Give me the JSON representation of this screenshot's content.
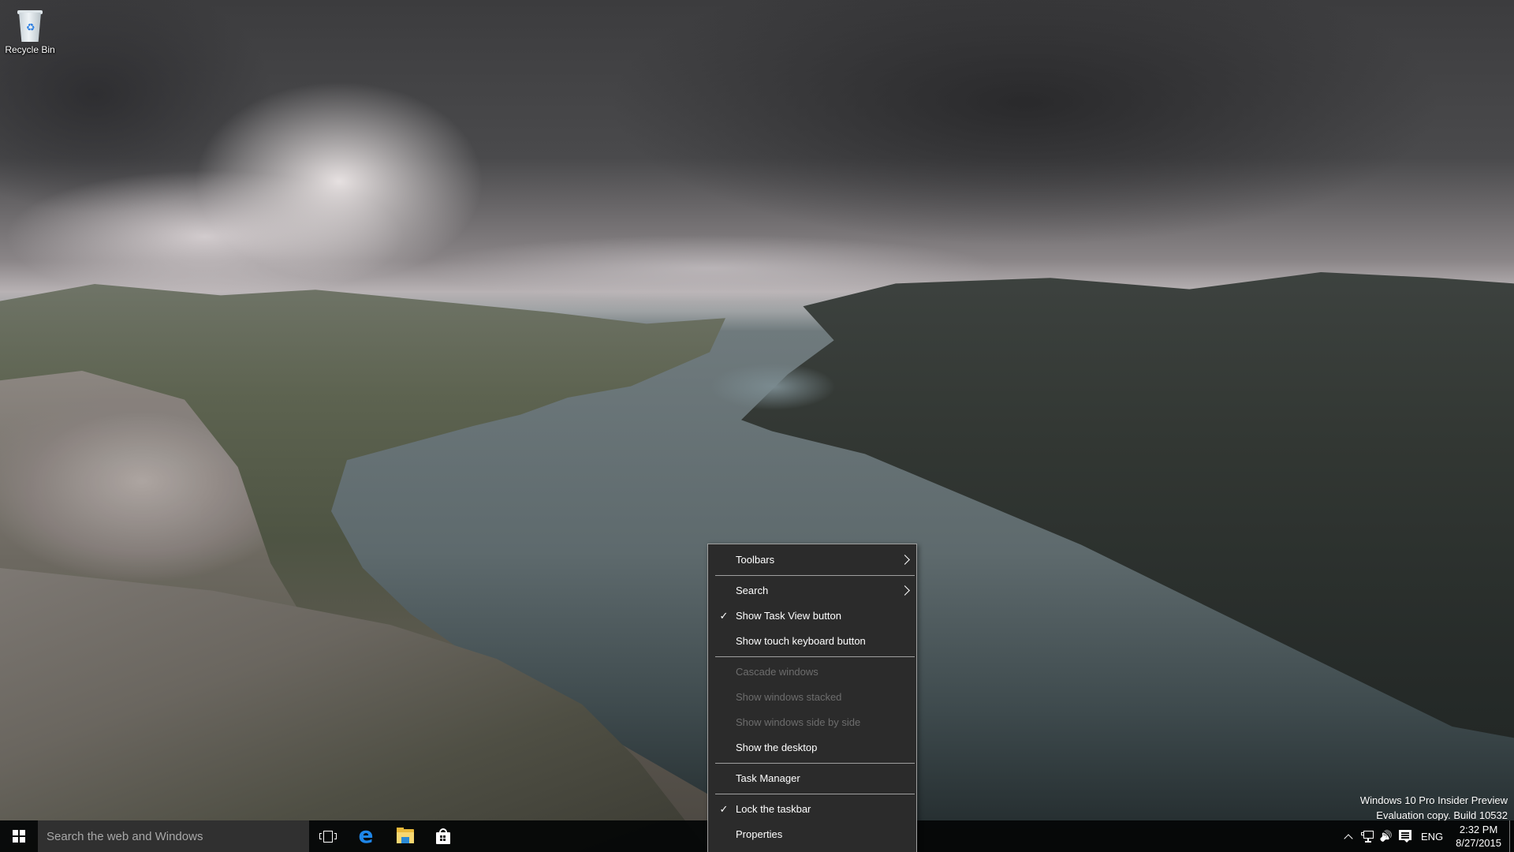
{
  "desktop": {
    "icons": [
      {
        "label": "Recycle Bin",
        "icon": "recycle-bin-icon"
      }
    ],
    "watermark": {
      "line1": "Windows 10 Pro Insider Preview",
      "line2": "Evaluation copy. Build 10532"
    }
  },
  "context_menu": {
    "items": [
      {
        "label": "Toolbars",
        "checked": false,
        "disabled": false,
        "submenu": true
      },
      {
        "separator": true
      },
      {
        "label": "Search",
        "checked": false,
        "disabled": false,
        "submenu": true
      },
      {
        "label": "Show Task View button",
        "checked": true,
        "disabled": false,
        "submenu": false
      },
      {
        "label": "Show touch keyboard button",
        "checked": false,
        "disabled": false,
        "submenu": false
      },
      {
        "separator": true
      },
      {
        "label": "Cascade windows",
        "checked": false,
        "disabled": true,
        "submenu": false
      },
      {
        "label": "Show windows stacked",
        "checked": false,
        "disabled": true,
        "submenu": false
      },
      {
        "label": "Show windows side by side",
        "checked": false,
        "disabled": true,
        "submenu": false
      },
      {
        "label": "Show the desktop",
        "checked": false,
        "disabled": false,
        "submenu": false
      },
      {
        "separator": true
      },
      {
        "label": "Task Manager",
        "checked": false,
        "disabled": false,
        "submenu": false
      },
      {
        "separator": true
      },
      {
        "label": "Lock the taskbar",
        "checked": true,
        "disabled": false,
        "submenu": false
      },
      {
        "label": "Properties",
        "checked": false,
        "disabled": false,
        "submenu": false
      }
    ],
    "check_glyph": "✓"
  },
  "taskbar": {
    "search": {
      "placeholder": "Search the web and Windows",
      "value": ""
    },
    "pinned": [
      {
        "name": "Task View",
        "icon": "task-view-icon"
      },
      {
        "name": "Microsoft Edge",
        "icon": "edge-icon",
        "glyph": "e",
        "color": "#1e86e8"
      },
      {
        "name": "File Explorer",
        "icon": "file-explorer-icon"
      },
      {
        "name": "Store",
        "icon": "store-icon"
      }
    ],
    "tray": {
      "language": "ENG",
      "time": "2:32 PM",
      "date": "8/27/2015",
      "volume_glyph": "🔊"
    }
  },
  "colors": {
    "menu_bg": "#2b2b2b",
    "menu_border": "#a0a0a0",
    "menu_disabled_text": "#6d6d6d",
    "search_bg": "#303030",
    "taskbar_bg": "#040606",
    "edge_blue": "#1e86e8"
  }
}
